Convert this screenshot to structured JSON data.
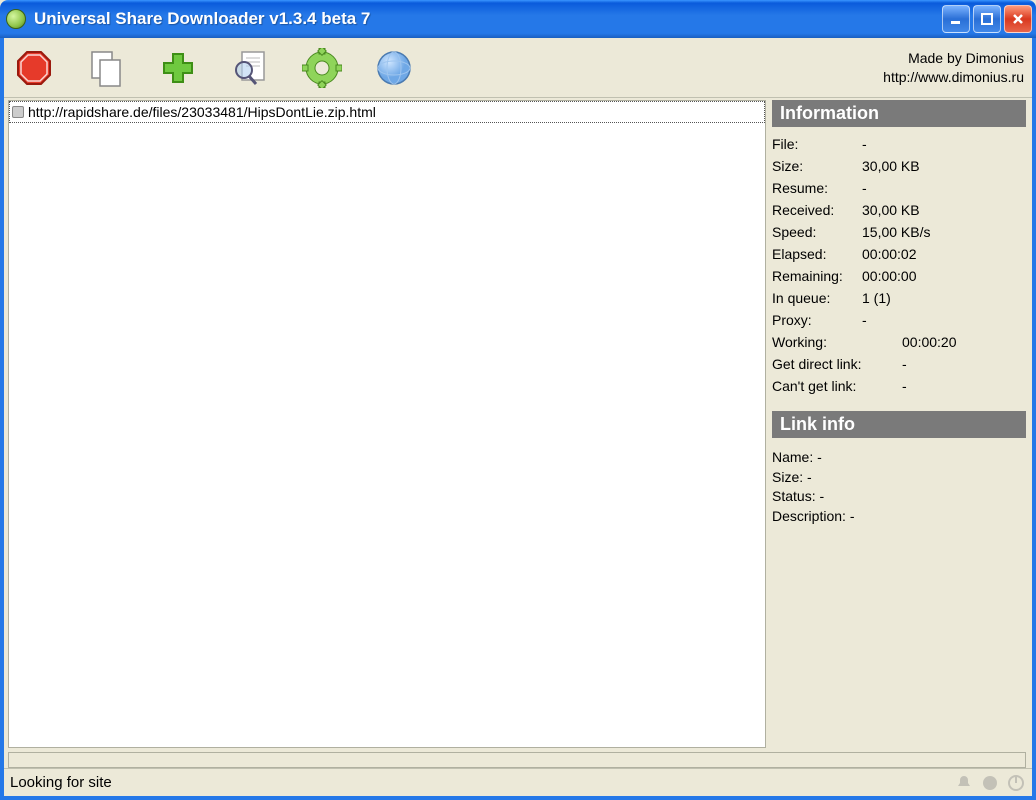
{
  "window": {
    "title": "Universal Share Downloader v1.3.4 beta 7"
  },
  "credit": {
    "line1": "Made by Dimonius",
    "line2": "http://www.dimonius.ru"
  },
  "downloads": [
    {
      "url": "http://rapidshare.de/files/23033481/HipsDontLie.zip.html"
    }
  ],
  "info": {
    "header": "Information",
    "rows": {
      "file_label": "File:",
      "file_value": "-",
      "size_label": "Size:",
      "size_value": "30,00 KB",
      "resume_label": "Resume:",
      "resume_value": "-",
      "received_label": "Received:",
      "received_value": "30,00 KB",
      "speed_label": "Speed:",
      "speed_value": "15,00 KB/s",
      "elapsed_label": "Elapsed:",
      "elapsed_value": "00:00:02",
      "remaining_label": "Remaining:",
      "remaining_value": "00:00:00",
      "inqueue_label": "In queue:",
      "inqueue_value": "1 (1)",
      "proxy_label": "Proxy:",
      "proxy_value": "-",
      "working_label": "Working:",
      "working_value": "00:00:20",
      "getlink_label": "Get direct link:",
      "getlink_value": "-",
      "cantget_label": "Can't get link:",
      "cantget_value": "-"
    }
  },
  "linkinfo": {
    "header": "Link info",
    "name_label": "Name:",
    "name_value": "-",
    "size_label": "Size:",
    "size_value": "-",
    "status_label": "Status:",
    "status_value": "-",
    "description_label": "Description:",
    "description_value": "-"
  },
  "statusbar": {
    "text": "Looking for site"
  }
}
